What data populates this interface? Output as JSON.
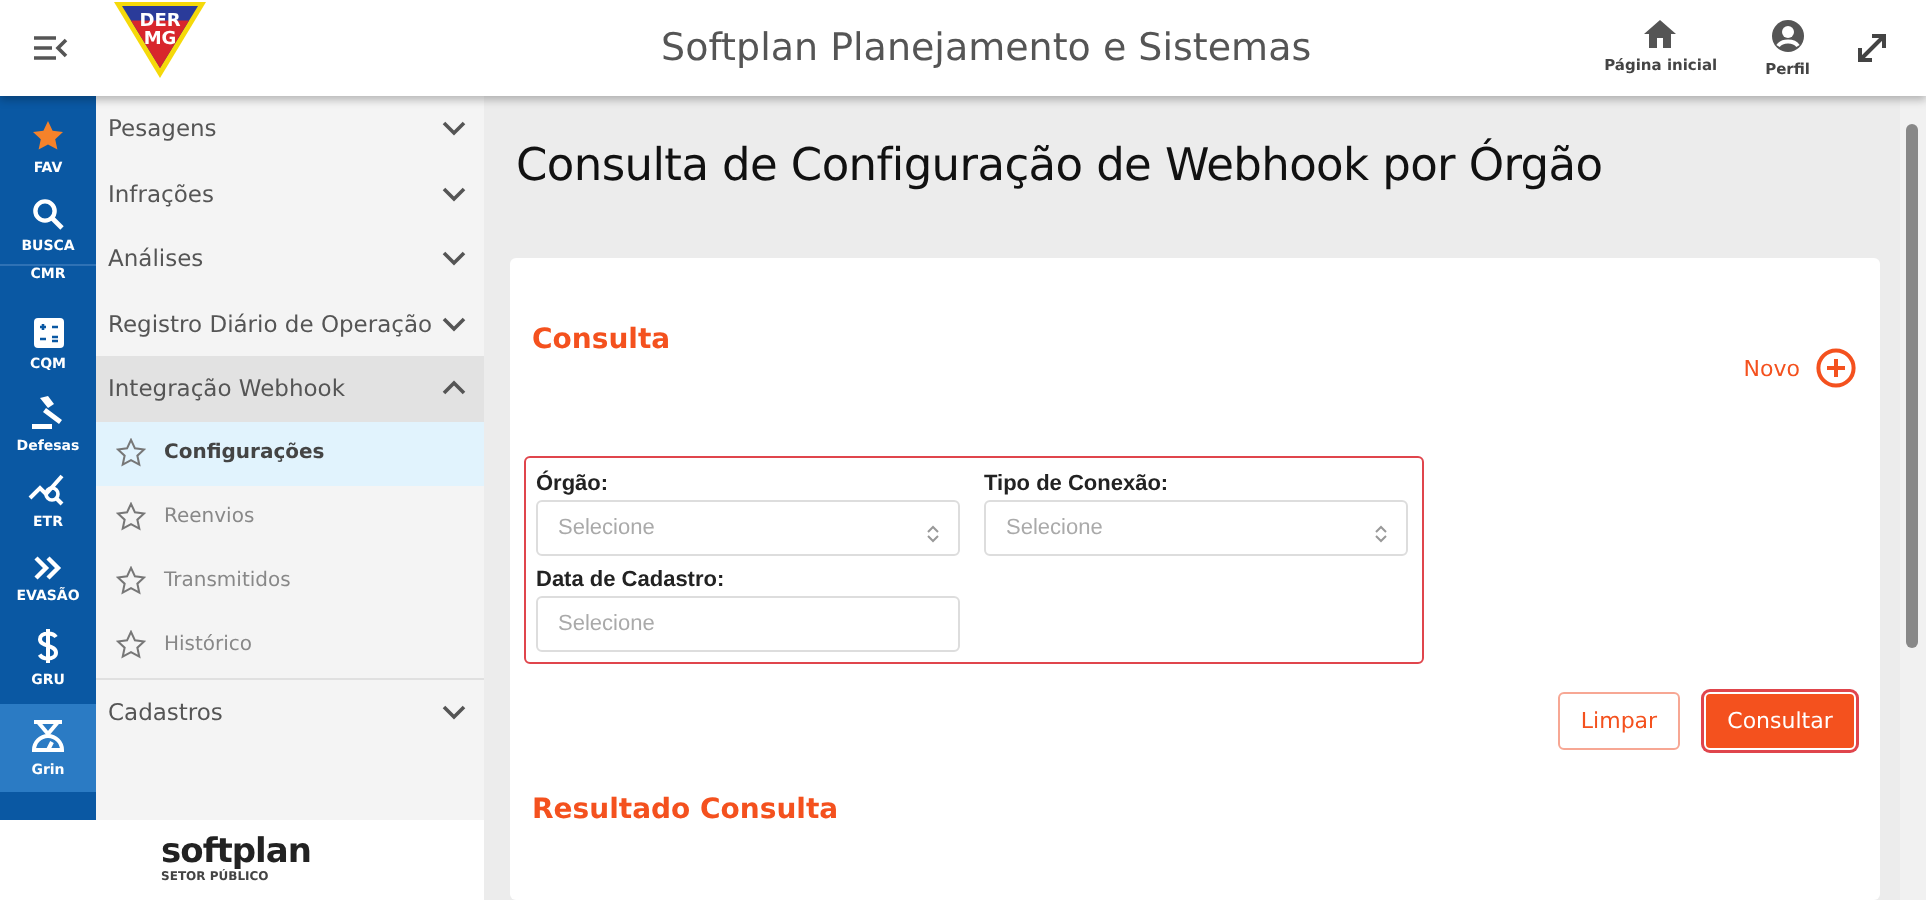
{
  "header": {
    "logo": {
      "lines": [
        "DER",
        "MG"
      ]
    },
    "title": "Softplan Planejamento e Sistemas",
    "actions": [
      {
        "label": "Página inicial"
      },
      {
        "label": "Perfil"
      }
    ]
  },
  "rail": [
    {
      "label": "FAV",
      "selected": false
    },
    {
      "label": "BUSCA",
      "selected": false
    },
    {
      "label": "CMR",
      "selected": false
    },
    {
      "label": "CQM",
      "selected": false
    },
    {
      "label": "Defesas",
      "selected": false
    },
    {
      "label": "ETR",
      "selected": false
    },
    {
      "label": "EVASÃO",
      "selected": false
    },
    {
      "label": "GRU",
      "selected": false
    },
    {
      "label": "Grin",
      "selected": true
    }
  ],
  "menu": [
    {
      "label": "Pesagens",
      "expanded": false
    },
    {
      "label": "Infrações",
      "expanded": false
    },
    {
      "label": "Análises",
      "expanded": false
    },
    {
      "label": "Registro Diário de Operação",
      "expanded": false
    },
    {
      "label": "Integração Webhook",
      "expanded": true,
      "children": [
        {
          "label": "Configurações",
          "selected": true
        },
        {
          "label": "Reenvios",
          "selected": false
        },
        {
          "label": "Transmitidos",
          "selected": false
        },
        {
          "label": "Histórico",
          "selected": false
        }
      ]
    },
    {
      "label": "Cadastros",
      "expanded": false
    }
  ],
  "footer": {
    "brand": "softplan",
    "tagline": "SETOR PÚBLICO"
  },
  "page": {
    "title": "Consulta de Configuração de Webhook por Órgão",
    "card": {
      "section": "Consulta",
      "new_label": "Novo",
      "fields": [
        {
          "label": "Órgão:",
          "placeholder": "Selecione",
          "kind": "select"
        },
        {
          "label": "Tipo de Conexão:",
          "placeholder": "Selecione",
          "kind": "select"
        },
        {
          "label": "Data de Cadastro:",
          "placeholder": "Selecione",
          "kind": "date"
        }
      ],
      "buttons": [
        {
          "label": "Limpar",
          "kind": "secondary"
        },
        {
          "label": "Consultar",
          "kind": "primary"
        }
      ],
      "result_title": "Resultado Consulta"
    }
  }
}
